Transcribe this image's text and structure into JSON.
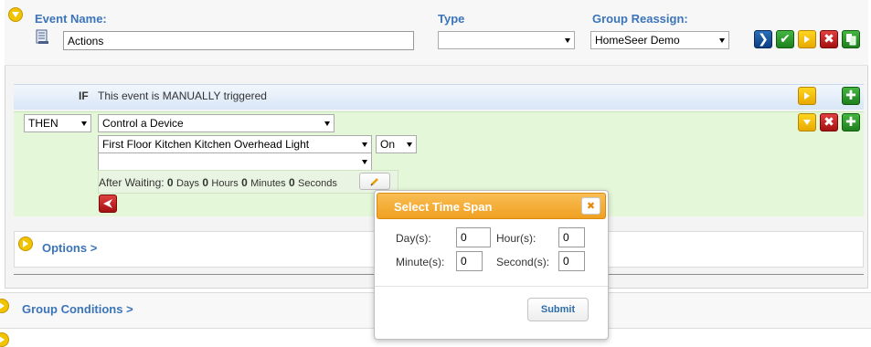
{
  "event": {
    "name_label": "Event Name:",
    "name_value": "Actions",
    "type_label": "Type",
    "type_value": "",
    "group_label": "Group Reassign:",
    "group_value": "HomeSeer Demo"
  },
  "trigger": {
    "if_label": "IF",
    "text": "This event is MANUALLY triggered"
  },
  "action": {
    "then_value": "THEN",
    "action_value": "Control a Device",
    "device_value": "First Floor Kitchen Kitchen Overhead Light",
    "state_value": "On",
    "second_value": "",
    "after_waiting_label": "After Waiting:",
    "days_value": "0",
    "days_unit": "Days",
    "hours_value": "0",
    "hours_unit": "Hours",
    "minutes_value": "0",
    "minutes_unit": "Minutes",
    "seconds_value": "0",
    "seconds_unit": "Seconds"
  },
  "options": {
    "label": "Options >"
  },
  "group_conditions": {
    "label": "Group Conditions >"
  },
  "dialog": {
    "title": "Select Time Span",
    "close_glyph": "✖",
    "days_label": "Day(s):",
    "days_value": "0",
    "hours_label": "Hour(s):",
    "hours_value": "0",
    "minutes_label": "Minute(s):",
    "minutes_value": "0",
    "seconds_label": "Second(s):",
    "seconds_value": "0",
    "submit_label": "Submit"
  },
  "icons": {
    "run": "❯",
    "save": "✔",
    "delete": "✖",
    "add": "✚"
  },
  "colors": {
    "accent_blue": "#3b74b9",
    "dialog_header": "#f5a82a",
    "trigger_bg": "#dde9f7",
    "action_bg": "#e4f7d9"
  }
}
